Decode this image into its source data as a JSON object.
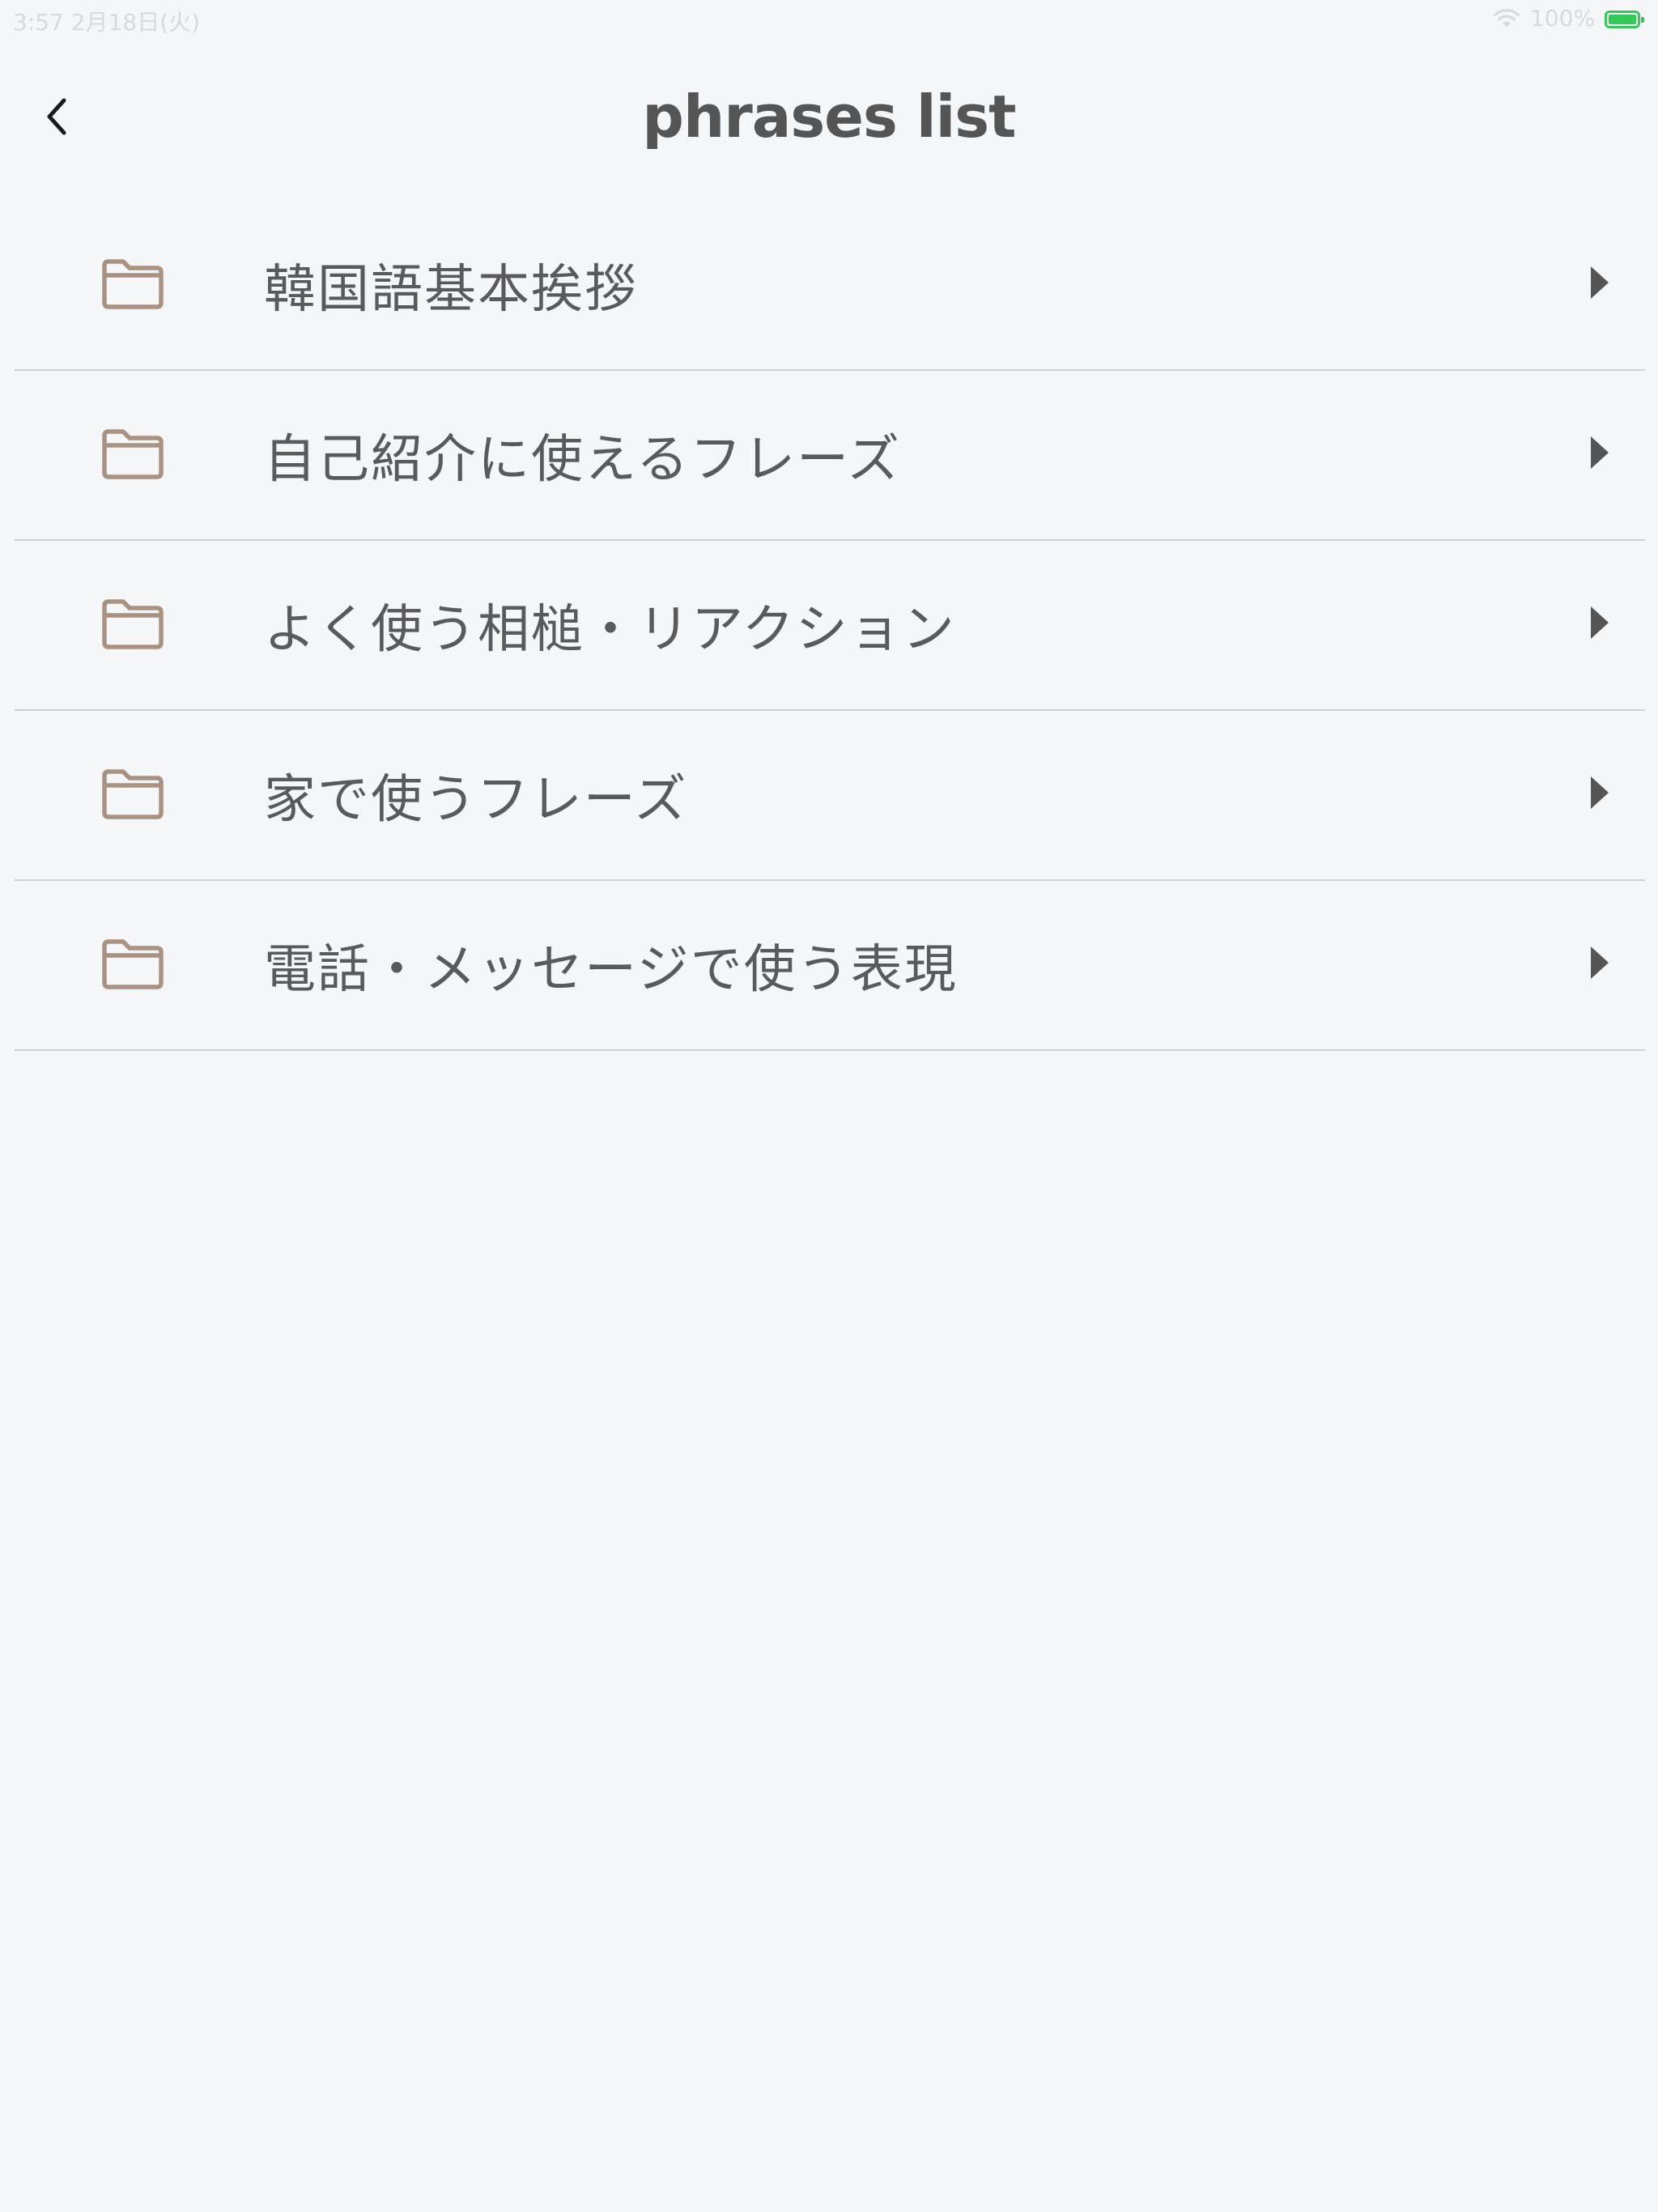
{
  "status_bar": {
    "time_date": "3:57   2月18日(火)",
    "battery_percent": "100%",
    "icons": [
      "wifi-icon",
      "battery-charging-icon"
    ]
  },
  "nav": {
    "title": "phrases list",
    "back_icon": "chevron-left-icon"
  },
  "list": {
    "items": [
      {
        "label": "韓国語基本挨拶",
        "icon": "folder-icon",
        "trailing_icon": "play-triangle-icon"
      },
      {
        "label": "自己紹介に使えるフレーズ",
        "icon": "folder-icon",
        "trailing_icon": "play-triangle-icon"
      },
      {
        "label": "よく使う相槌・リアクション",
        "icon": "folder-icon",
        "trailing_icon": "play-triangle-icon"
      },
      {
        "label": "家で使うフレーズ",
        "icon": "folder-icon",
        "trailing_icon": "play-triangle-icon"
      },
      {
        "label": "電話・メッセージで使う表現",
        "icon": "folder-icon",
        "trailing_icon": "play-triangle-icon"
      }
    ]
  },
  "colors": {
    "background": "#f5f6f8",
    "folder_icon": "#a89282",
    "text": "#555555",
    "divider": "#cfd0d3",
    "battery": "#34c759"
  }
}
